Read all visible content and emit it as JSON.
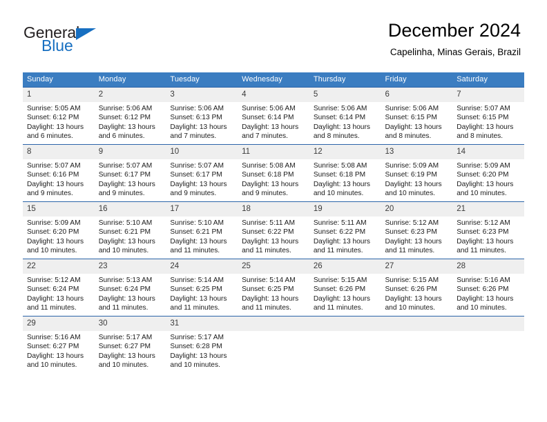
{
  "brand": {
    "word_general": "General",
    "word_blue": "Blue",
    "logo_icon": "triangle-logo-icon"
  },
  "header": {
    "title": "December 2024",
    "subtitle": "Capelinha, Minas Gerais, Brazil"
  },
  "colors": {
    "header_bar": "#3b7dc1",
    "cell_border_top": "#2a63a8",
    "daynum_band": "#efefef",
    "brand_blue": "#176fc1",
    "text": "#000000"
  },
  "weekday_headers": [
    "Sunday",
    "Monday",
    "Tuesday",
    "Wednesday",
    "Thursday",
    "Friday",
    "Saturday"
  ],
  "weeks": [
    {
      "days": [
        {
          "num": "1",
          "sunrise": "Sunrise: 5:05 AM",
          "sunset": "Sunset: 6:12 PM",
          "daylight": "Daylight: 13 hours and 6 minutes."
        },
        {
          "num": "2",
          "sunrise": "Sunrise: 5:06 AM",
          "sunset": "Sunset: 6:12 PM",
          "daylight": "Daylight: 13 hours and 6 minutes."
        },
        {
          "num": "3",
          "sunrise": "Sunrise: 5:06 AM",
          "sunset": "Sunset: 6:13 PM",
          "daylight": "Daylight: 13 hours and 7 minutes."
        },
        {
          "num": "4",
          "sunrise": "Sunrise: 5:06 AM",
          "sunset": "Sunset: 6:14 PM",
          "daylight": "Daylight: 13 hours and 7 minutes."
        },
        {
          "num": "5",
          "sunrise": "Sunrise: 5:06 AM",
          "sunset": "Sunset: 6:14 PM",
          "daylight": "Daylight: 13 hours and 8 minutes."
        },
        {
          "num": "6",
          "sunrise": "Sunrise: 5:06 AM",
          "sunset": "Sunset: 6:15 PM",
          "daylight": "Daylight: 13 hours and 8 minutes."
        },
        {
          "num": "7",
          "sunrise": "Sunrise: 5:07 AM",
          "sunset": "Sunset: 6:15 PM",
          "daylight": "Daylight: 13 hours and 8 minutes."
        }
      ]
    },
    {
      "days": [
        {
          "num": "8",
          "sunrise": "Sunrise: 5:07 AM",
          "sunset": "Sunset: 6:16 PM",
          "daylight": "Daylight: 13 hours and 9 minutes."
        },
        {
          "num": "9",
          "sunrise": "Sunrise: 5:07 AM",
          "sunset": "Sunset: 6:17 PM",
          "daylight": "Daylight: 13 hours and 9 minutes."
        },
        {
          "num": "10",
          "sunrise": "Sunrise: 5:07 AM",
          "sunset": "Sunset: 6:17 PM",
          "daylight": "Daylight: 13 hours and 9 minutes."
        },
        {
          "num": "11",
          "sunrise": "Sunrise: 5:08 AM",
          "sunset": "Sunset: 6:18 PM",
          "daylight": "Daylight: 13 hours and 9 minutes."
        },
        {
          "num": "12",
          "sunrise": "Sunrise: 5:08 AM",
          "sunset": "Sunset: 6:18 PM",
          "daylight": "Daylight: 13 hours and 10 minutes."
        },
        {
          "num": "13",
          "sunrise": "Sunrise: 5:09 AM",
          "sunset": "Sunset: 6:19 PM",
          "daylight": "Daylight: 13 hours and 10 minutes."
        },
        {
          "num": "14",
          "sunrise": "Sunrise: 5:09 AM",
          "sunset": "Sunset: 6:20 PM",
          "daylight": "Daylight: 13 hours and 10 minutes."
        }
      ]
    },
    {
      "days": [
        {
          "num": "15",
          "sunrise": "Sunrise: 5:09 AM",
          "sunset": "Sunset: 6:20 PM",
          "daylight": "Daylight: 13 hours and 10 minutes."
        },
        {
          "num": "16",
          "sunrise": "Sunrise: 5:10 AM",
          "sunset": "Sunset: 6:21 PM",
          "daylight": "Daylight: 13 hours and 10 minutes."
        },
        {
          "num": "17",
          "sunrise": "Sunrise: 5:10 AM",
          "sunset": "Sunset: 6:21 PM",
          "daylight": "Daylight: 13 hours and 11 minutes."
        },
        {
          "num": "18",
          "sunrise": "Sunrise: 5:11 AM",
          "sunset": "Sunset: 6:22 PM",
          "daylight": "Daylight: 13 hours and 11 minutes."
        },
        {
          "num": "19",
          "sunrise": "Sunrise: 5:11 AM",
          "sunset": "Sunset: 6:22 PM",
          "daylight": "Daylight: 13 hours and 11 minutes."
        },
        {
          "num": "20",
          "sunrise": "Sunrise: 5:12 AM",
          "sunset": "Sunset: 6:23 PM",
          "daylight": "Daylight: 13 hours and 11 minutes."
        },
        {
          "num": "21",
          "sunrise": "Sunrise: 5:12 AM",
          "sunset": "Sunset: 6:23 PM",
          "daylight": "Daylight: 13 hours and 11 minutes."
        }
      ]
    },
    {
      "days": [
        {
          "num": "22",
          "sunrise": "Sunrise: 5:12 AM",
          "sunset": "Sunset: 6:24 PM",
          "daylight": "Daylight: 13 hours and 11 minutes."
        },
        {
          "num": "23",
          "sunrise": "Sunrise: 5:13 AM",
          "sunset": "Sunset: 6:24 PM",
          "daylight": "Daylight: 13 hours and 11 minutes."
        },
        {
          "num": "24",
          "sunrise": "Sunrise: 5:14 AM",
          "sunset": "Sunset: 6:25 PM",
          "daylight": "Daylight: 13 hours and 11 minutes."
        },
        {
          "num": "25",
          "sunrise": "Sunrise: 5:14 AM",
          "sunset": "Sunset: 6:25 PM",
          "daylight": "Daylight: 13 hours and 11 minutes."
        },
        {
          "num": "26",
          "sunrise": "Sunrise: 5:15 AM",
          "sunset": "Sunset: 6:26 PM",
          "daylight": "Daylight: 13 hours and 11 minutes."
        },
        {
          "num": "27",
          "sunrise": "Sunrise: 5:15 AM",
          "sunset": "Sunset: 6:26 PM",
          "daylight": "Daylight: 13 hours and 10 minutes."
        },
        {
          "num": "28",
          "sunrise": "Sunrise: 5:16 AM",
          "sunset": "Sunset: 6:26 PM",
          "daylight": "Daylight: 13 hours and 10 minutes."
        }
      ]
    },
    {
      "days": [
        {
          "num": "29",
          "sunrise": "Sunrise: 5:16 AM",
          "sunset": "Sunset: 6:27 PM",
          "daylight": "Daylight: 13 hours and 10 minutes."
        },
        {
          "num": "30",
          "sunrise": "Sunrise: 5:17 AM",
          "sunset": "Sunset: 6:27 PM",
          "daylight": "Daylight: 13 hours and 10 minutes."
        },
        {
          "num": "31",
          "sunrise": "Sunrise: 5:17 AM",
          "sunset": "Sunset: 6:28 PM",
          "daylight": "Daylight: 13 hours and 10 minutes."
        },
        {
          "num": "",
          "sunrise": "",
          "sunset": "",
          "daylight": ""
        },
        {
          "num": "",
          "sunrise": "",
          "sunset": "",
          "daylight": ""
        },
        {
          "num": "",
          "sunrise": "",
          "sunset": "",
          "daylight": ""
        },
        {
          "num": "",
          "sunrise": "",
          "sunset": "",
          "daylight": ""
        }
      ]
    }
  ]
}
